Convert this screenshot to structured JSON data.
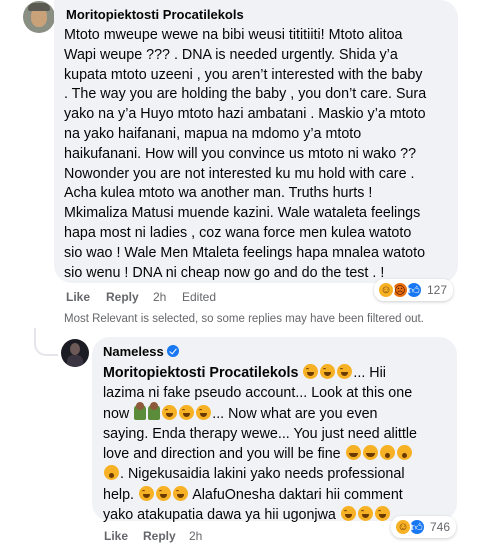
{
  "comment1": {
    "author": "Moritopiektosti Procatilekols",
    "lines": [
      "Mtoto mweupe wewe na bibi weusi tititiiti! Mtoto alitoa",
      "Wapi weupe ??? . DNA is needed urgently. Shida y’a",
      "kupata mtoto uzeeni , you aren’t interested with the baby",
      ". The way you are holding the baby , you don’t care. Sura",
      "yako na y’a Huyo mtoto hazi ambatani . Maskio y’a mtoto",
      "na yako haifanani, mapua na mdomo y’a mtoto",
      "haikufanani. How will you convince us mtoto ni wako ??",
      "Nowonder you are not interested ku mu hold with care .",
      "Acha kulea mtoto wa another man. Truths hurts !",
      "Mkimaliza Matusi muende kazini. Wale wataleta feelings",
      "hapa most ni ladies , coz wana force men kulea watoto",
      "sio wao ! Wale Men Mtaleta feelings hapa mnalea watoto",
      "sio wenu ! DNA ni cheap now go and do the test . !"
    ],
    "actions": {
      "like": "Like",
      "reply": "Reply",
      "time": "2h",
      "edited": "Edited"
    },
    "reaction_count": "127",
    "reaction_icons": [
      "haha-icon",
      "angry-icon",
      "like-icon"
    ]
  },
  "filter_notice": "Most Relevant is selected, so some replies may have been filtered out.",
  "reply1": {
    "author": "Nameless",
    "verified_icon": "verified-badge-icon",
    "mention": "Moritopiektosti Procatilekols",
    "line1_tail": "... Hii",
    "line2": "lazima ni fake pseudo account... Look at this one",
    "line3_head": "now",
    "line3_tail": "... Now what are you even",
    "line4": "saying. Enda therapy wewe... You just need alittle",
    "line5_head": "love and direction and you will be fine",
    "line6_tail": ". Nigekusaidia lakini yako needs professional",
    "line7_head": "help.",
    "line7_tail": "AlafuOnesha daktari hii comment",
    "line8_head": "yako atakupatia dawa ya hii ugonjwa",
    "actions": {
      "like": "Like",
      "reply": "Reply",
      "time": "2h"
    },
    "reaction_count": "746",
    "reaction_icons": [
      "haha-icon",
      "like-icon"
    ]
  }
}
